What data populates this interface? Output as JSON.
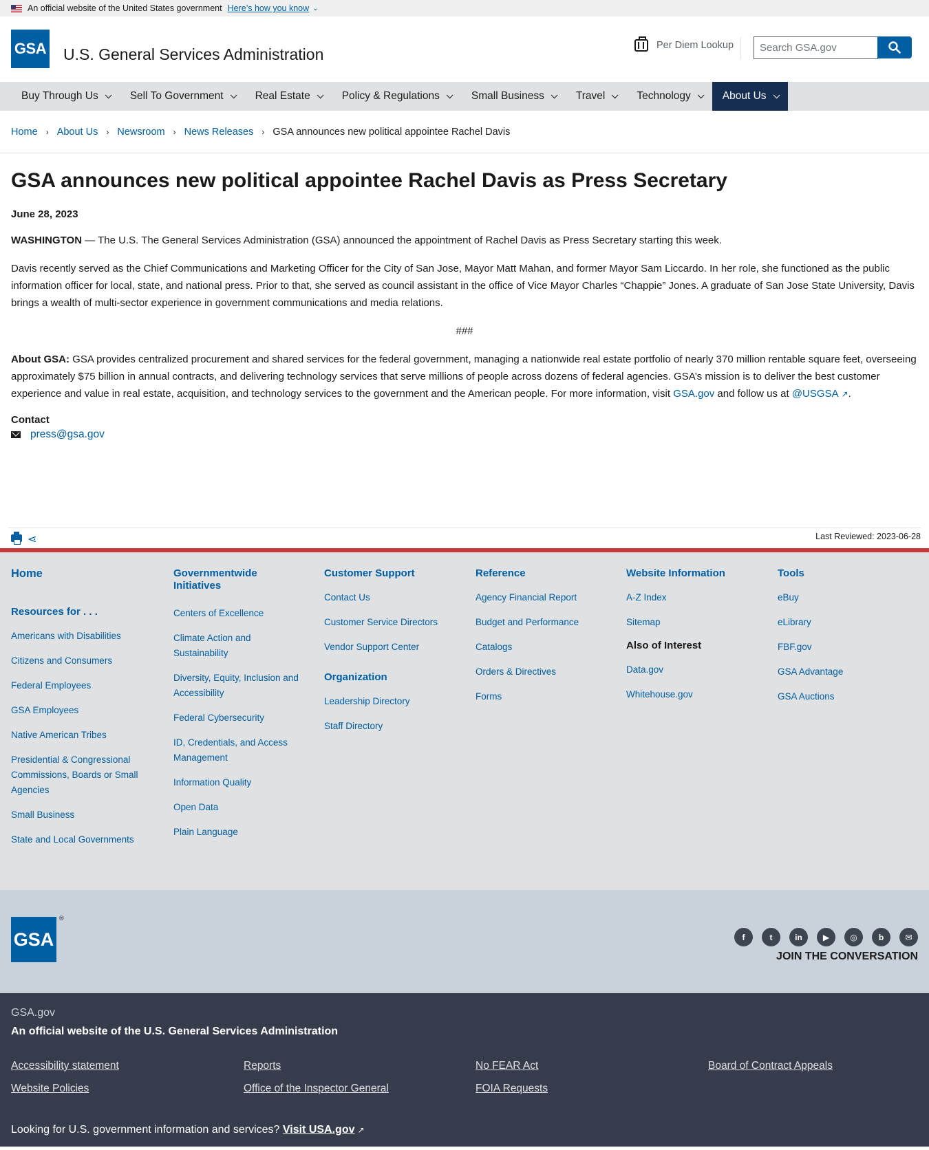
{
  "banner": {
    "text": "An official website of the United States government",
    "link": "Here’s how you know"
  },
  "header": {
    "logo": "GSA",
    "title": "U.S. General Services Administration",
    "per_diem": "Per Diem Lookup",
    "search_placeholder": "Search GSA.gov"
  },
  "nav": {
    "items": [
      {
        "label": "Buy Through Us"
      },
      {
        "label": "Sell To Government"
      },
      {
        "label": "Real Estate"
      },
      {
        "label": "Policy & Regulations"
      },
      {
        "label": "Small Business"
      },
      {
        "label": "Travel"
      },
      {
        "label": "Technology"
      },
      {
        "label": "About Us"
      }
    ]
  },
  "breadcrumb": {
    "items": [
      "Home",
      "About Us",
      "Newsroom",
      "News Releases"
    ],
    "current": "GSA announces new political appointee Rachel Davis"
  },
  "article": {
    "title": "GSA announces new political appointee Rachel Davis as Press Secretary",
    "date": "June 28, 2023",
    "dateline": "WASHINGTON",
    "lead": " — The U.S. The General Services Administration (GSA) announced the appointment of Rachel Davis as Press Secretary starting this week.",
    "para2": "Davis recently served as the Chief Communications and Marketing Officer for the City of San Jose, Mayor Matt Mahan, and former Mayor Sam Liccardo. In her role, she functioned as the public information officer for local, state, and national press. Prior to that, she served as council assistant in the office of Vice Mayor Charles “Chappie” Jones. A graduate of San Jose State University, Davis brings a wealth of multi-sector experience in government communications and media relations.",
    "separator": "###",
    "about_label": "About GSA:",
    "about_text": " GSA provides centralized procurement and shared services for the federal government, managing a nationwide real estate portfolio of nearly 370 million rentable square feet, overseeing approximately $75 billion in annual contracts, and delivering technology services that serve millions of people across dozens of federal agencies. GSA’s mission is to deliver the best customer experience and value in real estate, acquisition, and technology services to the government and the American people. For more information, visit ",
    "about_link1": "GSA.gov",
    "about_mid": " and follow us at ",
    "about_link2": "@USGSA",
    "about_end": ".",
    "contact_heading": "Contact",
    "contact_email": "press@gsa.gov",
    "last_reviewed": "Last Reviewed: 2023-06-28"
  },
  "footer": {
    "home": "Home",
    "resources_heading": "Resources for . . .",
    "resources": [
      "Americans with Disabilities",
      "Citizens and Consumers",
      "Federal Employees",
      "GSA Employees",
      "Native American Tribes",
      "Presidential & Congressional Commissions, Boards or Small Agencies",
      "Small Business",
      "State and Local Governments"
    ],
    "gov_heading": "Governmentwide Initiatives",
    "gov": [
      "Centers of Excellence",
      "Climate Action and Sustainability",
      "Diversity, Equity, Inclusion and Accessibility",
      "Federal Cybersecurity",
      "ID, Credentials, and Access Management",
      "Information Quality",
      "Open Data",
      "Plain Language"
    ],
    "support_heading": "Customer Support",
    "support": [
      "Contact Us",
      "Customer Service Directors",
      "Vendor Support Center"
    ],
    "org_heading": "Organization",
    "org": [
      "Leadership Directory",
      "Staff Directory"
    ],
    "ref_heading": "Reference",
    "ref": [
      "Agency Financial Report",
      "Budget and Performance",
      "Catalogs",
      "Orders & Directives",
      "Forms"
    ],
    "web_heading": "Website Information",
    "web": [
      "A-Z Index",
      "Sitemap"
    ],
    "interest_heading": "Also of Interest",
    "interest": [
      "Data.gov",
      "Whitehouse.gov"
    ],
    "tools_heading": "Tools",
    "tools": [
      "eBuy",
      "eLibrary",
      "FBF.gov",
      "GSA Advantage",
      "GSA Auctions"
    ]
  },
  "footer_secondary": {
    "logo": "GSA",
    "reg": "®",
    "join": "JOIN THE CONVERSATION",
    "socials": [
      "facebook-icon",
      "twitter-icon",
      "linkedin-icon",
      "youtube-icon",
      "instagram-icon",
      "blog-icon",
      "email-icon"
    ]
  },
  "identifier": {
    "domain": "GSA.gov",
    "official": "An official website of the U.S. General Services Administration",
    "links": [
      "Accessibility statement",
      "Reports",
      "No FEAR Act",
      "Board of Contract Appeals",
      "Website Policies",
      "Office of the Inspector General",
      "FOIA Requests"
    ],
    "usa_text": "Looking for U.S. government information and services? ",
    "usa_link": "Visit USA.gov"
  }
}
